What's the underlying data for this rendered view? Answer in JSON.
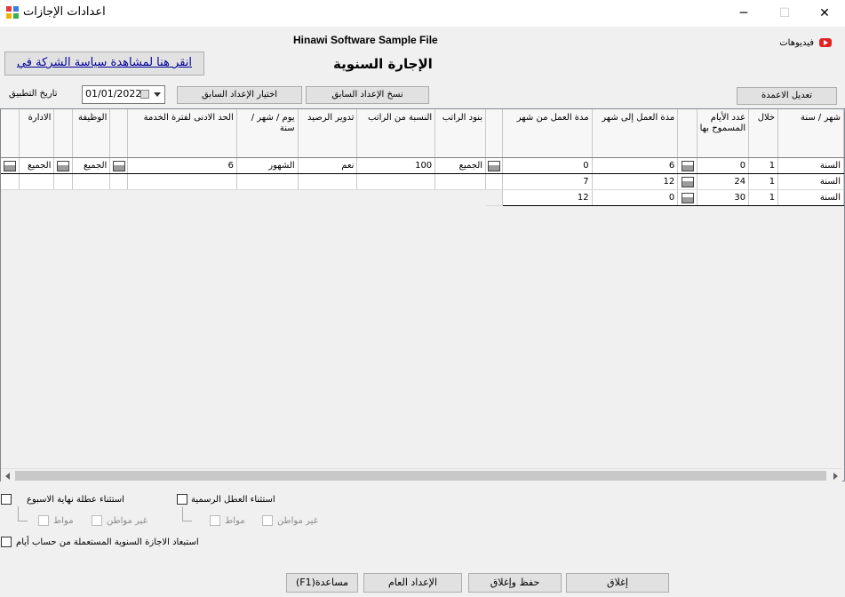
{
  "window": {
    "title": "اعدادات الإجازات",
    "minimize": "─",
    "maximize": "☐",
    "close": "✕"
  },
  "header": {
    "company": "Hinawi Software Sample File",
    "heading": "الإجارة السنوية",
    "videos_label": "فيديوهات",
    "policy_link": "انقر هنا لمشاهدة سياسة الشركة في"
  },
  "toolbar": {
    "date_label": "تاريخ التطبيق",
    "date_value": "01/01/2022",
    "choose_prev": "اختيار الإعداد السابق",
    "copy_prev": "نسخ الإعداد السابق",
    "edit_columns": "تعديل الاعمدة"
  },
  "grid": {
    "columns": [
      "شهر / سنة",
      "خلال",
      "عدد الأيام المسموح بها",
      "",
      "مدة العمل إلى شهر",
      "مدة العمل من شهر",
      "",
      "بنود الراتب",
      "النسبة من الراتب",
      "تدوير الرصيد",
      "يوم / شهر / سنة",
      "الحد الادنى لفترة الخدمة",
      "",
      "الوظيفة",
      "",
      "الادارة",
      ""
    ],
    "rows": [
      {
        "period": "السنة",
        "within": "1",
        "days": "0",
        "to": "6",
        "from": "0",
        "salary": "الجميع",
        "percent": "100",
        "rollover": "نعم",
        "unit": "الشهور",
        "min_service": "6",
        "job": "الجميع",
        "dept": "الجميع"
      },
      {
        "period": "السنة",
        "within": "1",
        "days": "24",
        "to": "12",
        "from": "7",
        "salary": "",
        "percent": "",
        "rollover": "",
        "unit": "",
        "min_service": "",
        "job": "",
        "dept": ""
      },
      {
        "period": "السنة",
        "within": "1",
        "days": "30",
        "to": "0",
        "from": "12",
        "salary": "",
        "percent": "",
        "rollover": "",
        "unit": "",
        "min_service": "",
        "job": "",
        "dept": ""
      }
    ]
  },
  "options": {
    "exclude_holidays": "استثناء العطل الرسمية",
    "exclude_weekend": "استثناء عطلة نهاية الاسبوع",
    "citizen": "مواط",
    "non_citizen": "غير مواطن",
    "exclude_annual": "استبعاد الاجازة السنوية المستعملة من حساب أيام"
  },
  "footer": {
    "close": "إغلاق",
    "save_close": "حفظ وإغلاق",
    "general_settings": "الإعداد العام",
    "help": "(F1)مساعدة"
  }
}
